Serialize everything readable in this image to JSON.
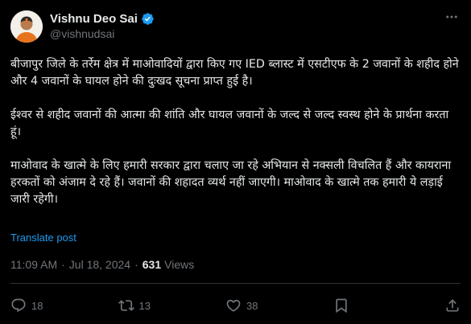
{
  "author": {
    "display_name": "Vishnu Deo Sai",
    "handle": "@vishnudsai",
    "verified": true
  },
  "tweet": {
    "paragraphs": [
      "बीजापुर जिले के तर्रेम क्षेत्र में माओवादियों द्वारा किए गए IED ब्लास्ट में एसटीएफ के 2 जवानों के शहीद होने और 4 जवानों के घायल होने की दुःखद सूचना प्राप्त हुई है।",
      "ईश्वर से शहीद जवानों की आत्मा की शांति और घायल जवानों के जल्द से जल्द स्वस्थ होने के प्रार्थना करता हूं।",
      "माओवाद के खात्मे के लिए हमारी सरकार द्वारा चलाए जा रहे अभियान से नक्सली विचलित हैं और कायराना हरकतों को अंजाम दे रहे हैं। जवानों की शहादत व्यर्थ नहीं जाएगी। माओवाद के खात्मे तक हमारी ये लड़ाई जारी रहेगी।"
    ],
    "translate_label": "Translate post",
    "time": "11:09 AM",
    "date": "Jul 18, 2024",
    "separator": "·",
    "views_count": "631",
    "views_label": "Views"
  },
  "actions": {
    "replies": "18",
    "reposts": "13",
    "likes": "38"
  },
  "icons": {
    "more": "more-icon",
    "verified": "verified-badge-icon",
    "reply": "reply-icon",
    "repost": "repost-icon",
    "like": "heart-icon",
    "bookmark": "bookmark-icon",
    "share": "share-icon"
  },
  "colors": {
    "background": "#000000",
    "text": "#e7e9ea",
    "muted": "#71767b",
    "accent": "#1d9bf0",
    "divider": "#2f3336"
  }
}
